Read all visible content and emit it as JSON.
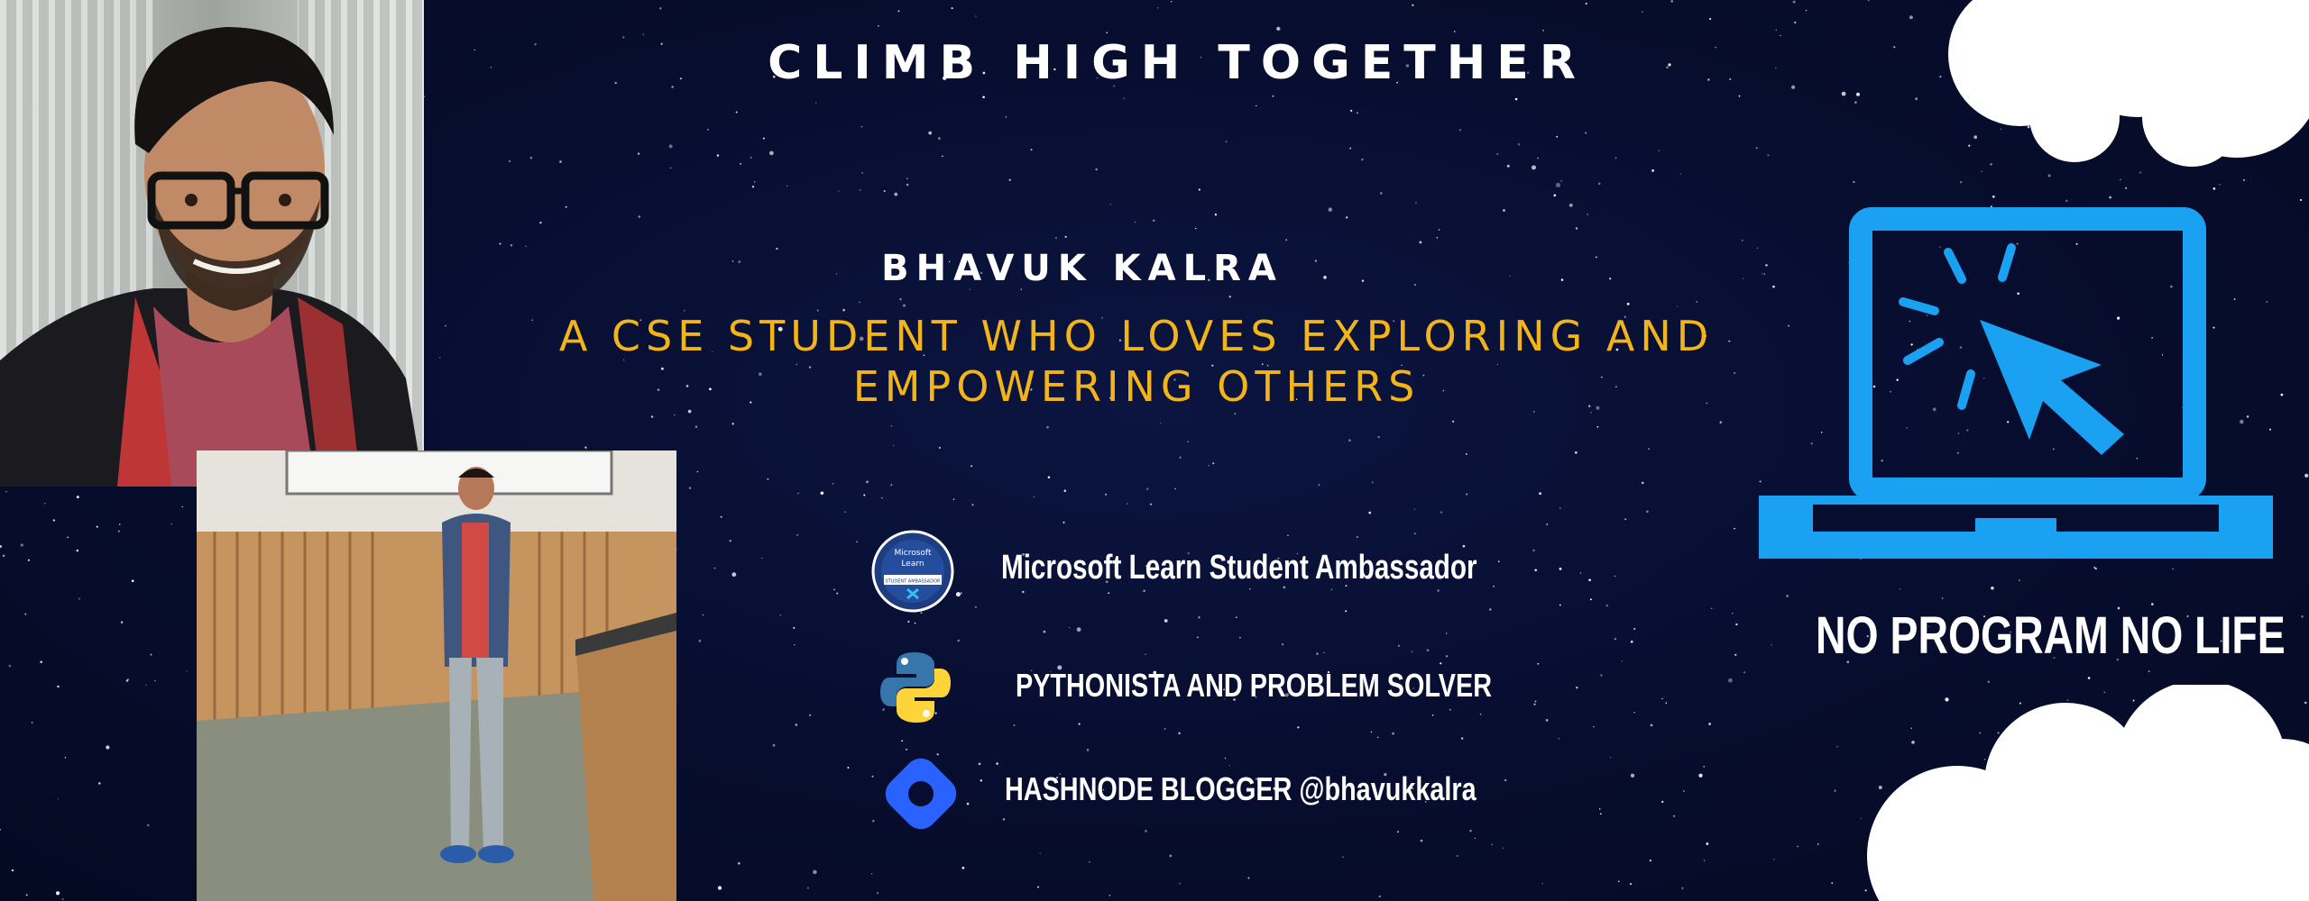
{
  "banner": {
    "title": "CLIMB HIGH TOGETHER",
    "name": "BHAVUK KALRA",
    "tagline_line1": "A CSE STUDENT WHO LOVES EXPLORING AND",
    "tagline_line2": "EMPOWERING OTHERS",
    "motto": "NO PROGRAM NO LIFE"
  },
  "badges": [
    {
      "icon": "microsoft-learn-ambassador-icon",
      "label": "Microsoft Learn Student Ambassador",
      "icon_text_top": "Microsoft",
      "icon_text_mid": "Learn",
      "icon_text_bottom": "STUDENT AMBASSADOR"
    },
    {
      "icon": "python-logo-icon",
      "label": "PYTHONISTA AND PROBLEM SOLVER"
    },
    {
      "icon": "hashnode-logo-icon",
      "label": "HASHNODE BLOGGER @bhavukkalra"
    }
  ],
  "colors": {
    "background": "#070d2e",
    "accent_yellow": "#f2b418",
    "laptop_blue": "#1ba1f2",
    "hashnode_blue": "#2962ff",
    "python_blue": "#3776ab",
    "python_yellow": "#ffd43b"
  }
}
